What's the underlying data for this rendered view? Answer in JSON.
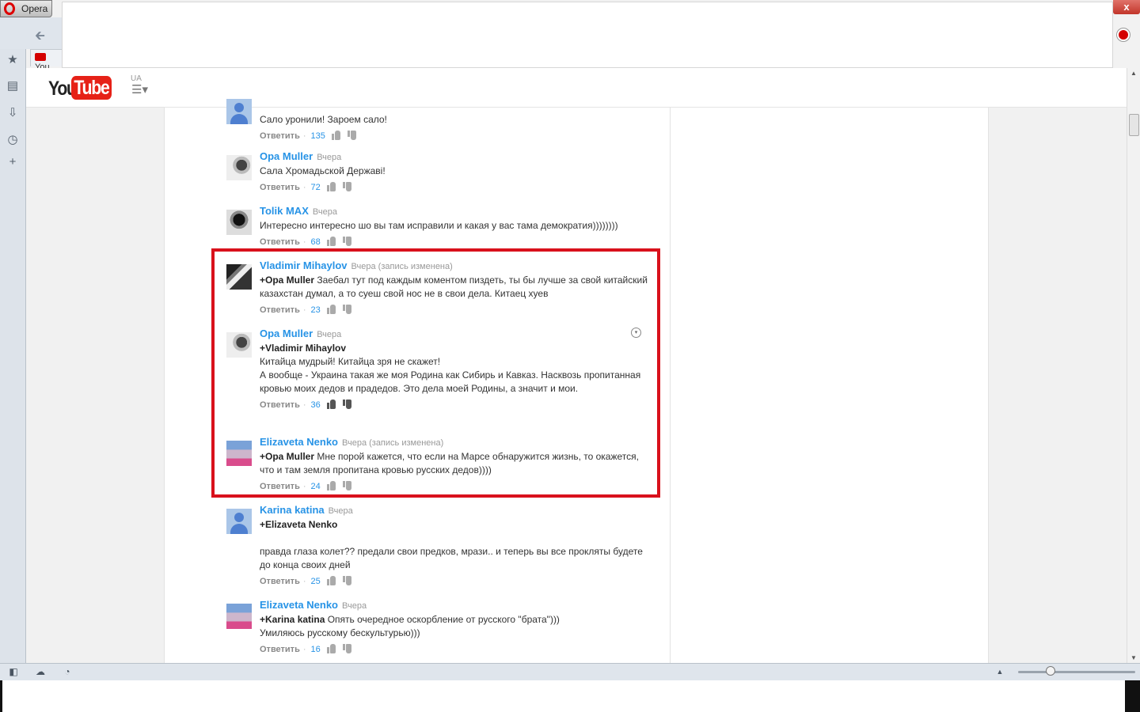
{
  "browser": {
    "menu_label": "Opera",
    "tab_label": "You",
    "close_label": "x"
  },
  "youtube": {
    "logo_you": "You",
    "logo_tube": "Tube",
    "region": "UA"
  },
  "comments": [
    {
      "author": "",
      "time": "",
      "avatar": "default",
      "text_html": "Сало уронили! Зароем сало!",
      "reply_label": "Ответить",
      "likes": "135"
    },
    {
      "author": "Opa Muller",
      "time": "Вчера",
      "avatar": "photo-gray",
      "text_html": "Сала Хромадьской Державi!",
      "reply_label": "Ответить",
      "likes": "72"
    },
    {
      "author": "Tolik MAX",
      "time": "Вчера",
      "avatar": "photo-dark",
      "text_html": "Интересно интересно шо вы там исправили и какая у вас тама демократия))))))))",
      "reply_label": "Ответить",
      "likes": "68"
    },
    {
      "author": "Vladimir Mihaylov",
      "time": "Вчера (запись изменена)",
      "avatar": "photo-piano",
      "mention": "+Opa Muller",
      "text_html": "Заебал тут под каждым коментом пиздеть, ты бы лучше за свой китайский казахстан думал, а то суеш  свой нос не в свои дела. Китаец хуев",
      "reply_label": "Ответить",
      "likes": "23"
    },
    {
      "author": "Opa Muller",
      "time": "Вчера",
      "avatar": "photo-gray",
      "mention": "+Vladimir Mihaylov",
      "text_lines": [
        "Китайца мудрый! Китайца зря не скажет!",
        "А вообще - Украина такая же моя Родина как Сибирь и Кавказ. Насквозь пропитанная кровью моих дедов и прадедов. Это дела моей Родины, а значит и мои."
      ],
      "reply_label": "Ответить",
      "likes": "36"
    },
    {
      "author": "Elizaveta Nenko",
      "time": "Вчера (запись изменена)",
      "avatar": "photo-city",
      "mention": "+Opa Muller",
      "text_html": "Мне порой кажется, что если на Марсе обнаружится жизнь, то окажется, что и там земля пропитана кровью русских дедов))))",
      "reply_label": "Ответить",
      "likes": "24"
    },
    {
      "author": "Karina katina",
      "time": "Вчера",
      "avatar": "default",
      "mention": "+Elizaveta Nenko",
      "text_html": "правда глаза колет?? предали свои предков, мрази.. и теперь вы все прокляты будете до конца своих дней",
      "reply_label": "Ответить",
      "likes": "25"
    },
    {
      "author": "Elizaveta Nenko",
      "time": "Вчера",
      "avatar": "photo-city",
      "mention": "+Karina katina",
      "text_html": "Опять очередное оскорбление от русского \"брата\")))",
      "text_line2": "Умиляюсь русскому бескультурью)))",
      "reply_label": "Ответить",
      "likes": "16"
    }
  ],
  "colors": {
    "author": "#2793e6",
    "highlight": "#d9111c",
    "youtube_red": "#e62117"
  }
}
